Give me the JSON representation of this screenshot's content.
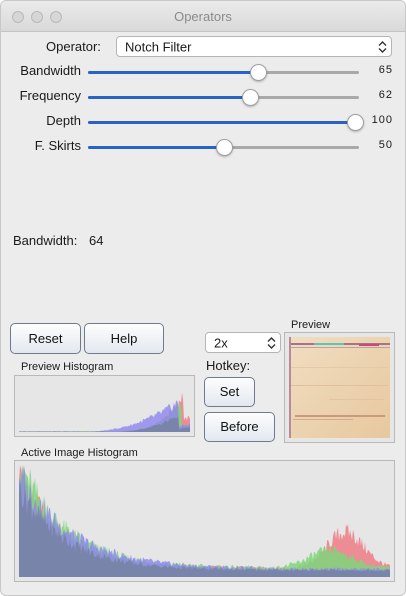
{
  "window": {
    "title": "Operators"
  },
  "operator": {
    "label": "Operator:",
    "value": "Notch Filter"
  },
  "sliders": [
    {
      "label": "Bandwidth",
      "value": "65",
      "fraction": 0.63
    },
    {
      "label": "Frequency",
      "value": "62",
      "fraction": 0.6
    },
    {
      "label": "Depth",
      "value": "100",
      "fraction": 1.0
    },
    {
      "label": "F. Skirts",
      "value": "50",
      "fraction": 0.5
    }
  ],
  "readout": {
    "label": "Bandwidth:",
    "value": "64"
  },
  "buttons": {
    "reset": "Reset",
    "help": "Help",
    "set": "Set",
    "before": "Before"
  },
  "zoom": {
    "value": "2x"
  },
  "hotkey": {
    "label": "Hotkey:"
  },
  "preview": {
    "label": "Preview"
  },
  "preview_histogram": {
    "label": "Preview Histogram"
  },
  "active_histogram": {
    "label": "Active Image Histogram"
  },
  "colors": {
    "accent": "#2a63c6",
    "hist_red": "#ef7b86",
    "hist_green": "#7ed67a",
    "hist_blue": "#8c86ee",
    "hist_gray": "#6b7a8a"
  }
}
